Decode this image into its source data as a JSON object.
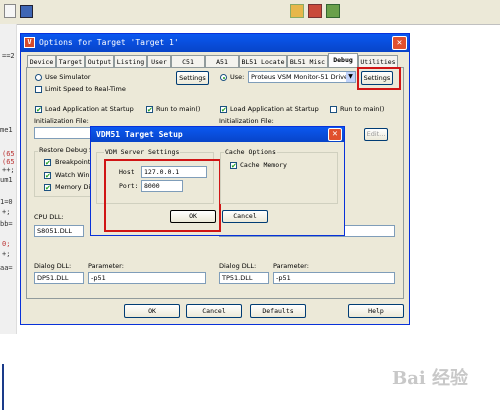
{
  "background_editor": {
    "code_fragments": [
      "==2",
      "me1",
      "(65",
      "(65",
      "++;",
      "um1",
      "1=0",
      "+;",
      "bb=",
      "0;",
      "+;",
      "aa="
    ],
    "toolbar_icons": [
      "new-icon",
      "save-icon",
      "build-icon",
      "debug-icon",
      "settings-icon"
    ]
  },
  "options_dialog": {
    "title": "Options for Target 'Target 1'",
    "tabs": [
      "Device",
      "Target",
      "Output",
      "Listing",
      "User",
      "C51",
      "A51",
      "BL51 Locate",
      "BL51 Misc",
      "Debug",
      "Utilities"
    ],
    "active_tab": "Debug",
    "left": {
      "use_simulator": "Use Simulator",
      "settings": "Settings",
      "limit_speed": "Limit Speed to Real-Time",
      "load_app": "Load Application at Startup",
      "run_to_main": "Run to main()",
      "init_file": "Initialization File:",
      "restore_group": "Restore Debug S",
      "breakpoints": "Breakpoints",
      "watch_windows": "Watch Win",
      "memory_display": "Memory Dis",
      "cpu_dll": "CPU DLL:",
      "cpu_dll_value": "S8051.DLL",
      "dialog_dll": "Dialog DLL:",
      "dialog_dll_value": "DP51.DLL",
      "parameter": "Parameter:",
      "parameter_value": "-p51"
    },
    "right": {
      "use": "Use:",
      "driver": "Proteus VSM Monitor-51 Driver",
      "settings": "Settings",
      "load_app": "Load Application at Startup",
      "run_to_main": "Run to main()",
      "init_file": "Initialization File:",
      "edit": "Edit...",
      "dialog_dll": "Dialog DLL:",
      "dialog_dll_value": "TP51.DLL",
      "parameter": "Parameter:",
      "parameter_value": "-p51"
    },
    "buttons": {
      "ok": "OK",
      "cancel": "Cancel",
      "defaults": "Defaults",
      "help": "Help"
    }
  },
  "vdm_dialog": {
    "title": "VDM51 Target Setup",
    "server_group": "VDM Server Settings",
    "host_label": "Host",
    "host_value": "127.0.0.1",
    "port_label": "Port:",
    "port_value": "8000",
    "cache_group": "Cache Options",
    "cache_memory": "Cache Memory",
    "ok": "OK",
    "cancel": "Cancel"
  },
  "watermark": "Bai 经验",
  "colors": {
    "highlight": "#d01515",
    "title_blue": "#0a58f0",
    "dialog_face": "#ece9d8"
  }
}
